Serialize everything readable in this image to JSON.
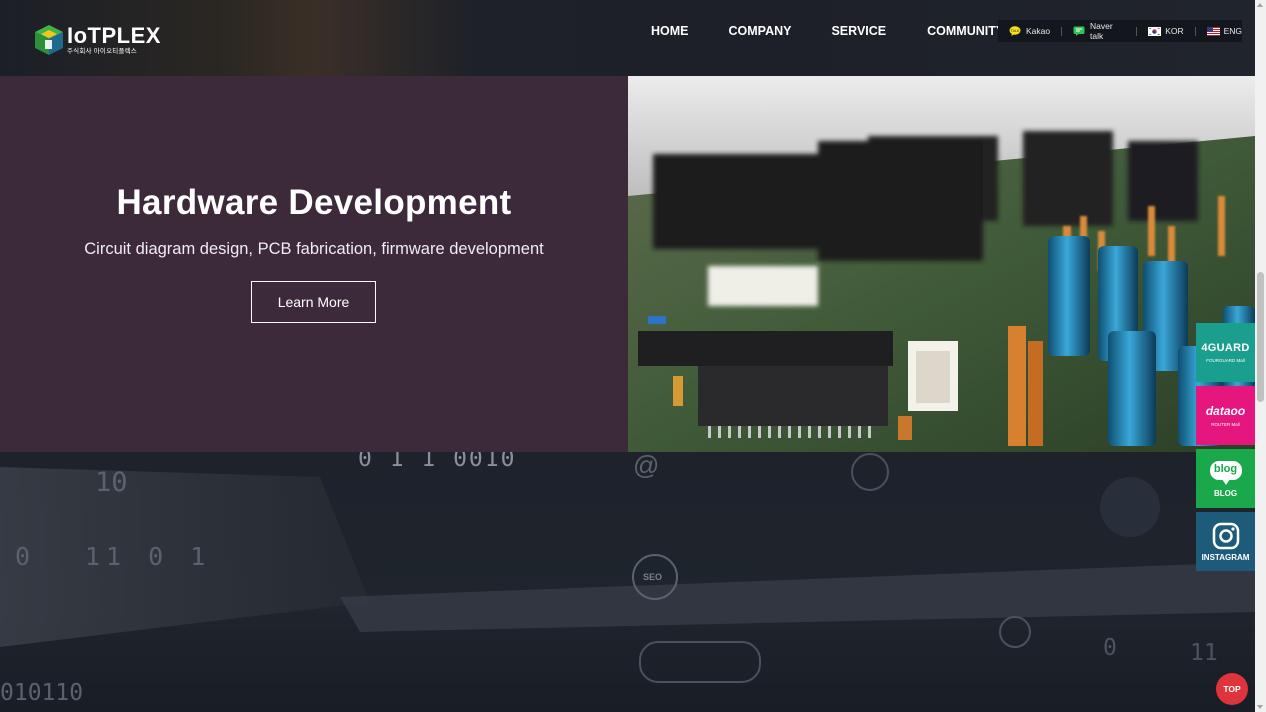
{
  "header": {
    "logo": {
      "name": "IoTPLEX",
      "subtitle": "주식회사 아이오티플렉스"
    },
    "nav": [
      {
        "label": "HOME"
      },
      {
        "label": "COMPANY"
      },
      {
        "label": "SERVICE"
      },
      {
        "label": "COMMUNITY"
      }
    ],
    "utility": [
      {
        "label": "Kakao",
        "icon": "kakao-talk-icon"
      },
      {
        "label": "Naver talk",
        "icon": "naver-talk-icon"
      },
      {
        "label": "KOR",
        "icon": "korea-flag-icon"
      },
      {
        "label": "ENG",
        "icon": "usa-flag-icon"
      }
    ]
  },
  "hero": {
    "title": "Hardware Development",
    "subtitle": "Circuit diagram design, PCB fabrication, firmware development",
    "button_label": "Learn More"
  },
  "background_text": {
    "line1": "0 1 1 0010",
    "line2": "10",
    "line3": "0",
    "line4": "11 0 1",
    "line5": "010110",
    "line6": "@",
    "line7": "SEO",
    "line8": "0",
    "line9": "11"
  },
  "quick_links": [
    {
      "brand": "4GUARD",
      "caption": "FOURGUARD Mall",
      "color": "#1a9f8f"
    },
    {
      "brand": "dataoo",
      "caption": "ROUTER Mall",
      "color": "#e5177f"
    },
    {
      "brand": "blog",
      "caption": "BLOG",
      "color": "#19a84a"
    },
    {
      "brand": "instagram",
      "caption": "INSTAGRAM",
      "color": "#1e5b7a"
    }
  ],
  "top_button": {
    "label": "TOP"
  }
}
